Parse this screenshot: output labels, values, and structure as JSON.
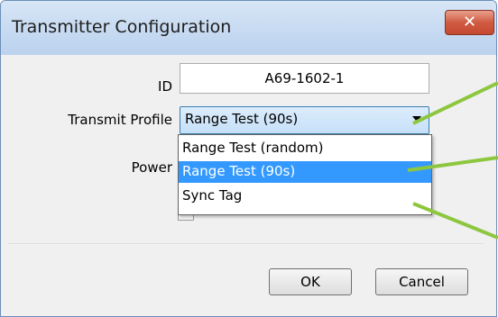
{
  "window": {
    "title": "Transmitter Configuration",
    "close_icon_glyph": "✕"
  },
  "form": {
    "id_label": "ID",
    "id_value": "A69-1602-1",
    "profile_label": "Transmit Profile",
    "profile_value": "Range Test (90s)",
    "power_label": "Power"
  },
  "dropdown": {
    "options": [
      {
        "label": "Range Test (random)",
        "selected": false
      },
      {
        "label": "Range Test (90s)",
        "selected": true
      },
      {
        "label": "Sync Tag",
        "selected": false
      }
    ]
  },
  "buttons": {
    "ok": "OK",
    "cancel": "Cancel"
  },
  "colors": {
    "accent_callout": "#8dc63f",
    "selection": "#3399ff",
    "close_button": "#c44a30"
  }
}
